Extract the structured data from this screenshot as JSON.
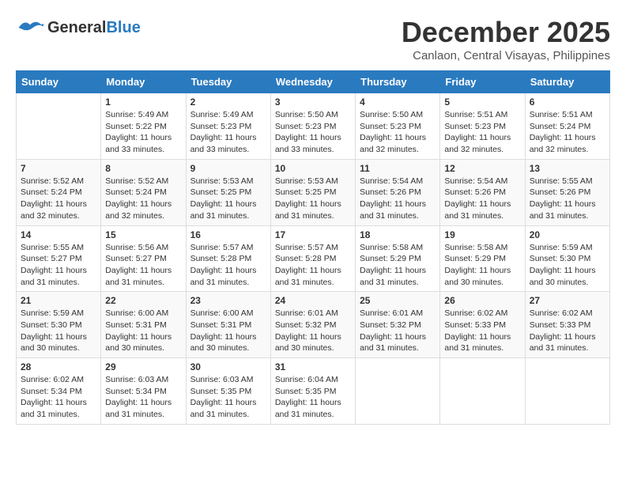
{
  "header": {
    "logo_general": "General",
    "logo_blue": "Blue",
    "month": "December 2025",
    "location": "Canlaon, Central Visayas, Philippines"
  },
  "weekdays": [
    "Sunday",
    "Monday",
    "Tuesday",
    "Wednesday",
    "Thursday",
    "Friday",
    "Saturday"
  ],
  "weeks": [
    [
      {
        "day": "",
        "info": ""
      },
      {
        "day": "1",
        "info": "Sunrise: 5:49 AM\nSunset: 5:22 PM\nDaylight: 11 hours\nand 33 minutes."
      },
      {
        "day": "2",
        "info": "Sunrise: 5:49 AM\nSunset: 5:23 PM\nDaylight: 11 hours\nand 33 minutes."
      },
      {
        "day": "3",
        "info": "Sunrise: 5:50 AM\nSunset: 5:23 PM\nDaylight: 11 hours\nand 33 minutes."
      },
      {
        "day": "4",
        "info": "Sunrise: 5:50 AM\nSunset: 5:23 PM\nDaylight: 11 hours\nand 32 minutes."
      },
      {
        "day": "5",
        "info": "Sunrise: 5:51 AM\nSunset: 5:23 PM\nDaylight: 11 hours\nand 32 minutes."
      },
      {
        "day": "6",
        "info": "Sunrise: 5:51 AM\nSunset: 5:24 PM\nDaylight: 11 hours\nand 32 minutes."
      }
    ],
    [
      {
        "day": "7",
        "info": "Sunrise: 5:52 AM\nSunset: 5:24 PM\nDaylight: 11 hours\nand 32 minutes."
      },
      {
        "day": "8",
        "info": "Sunrise: 5:52 AM\nSunset: 5:24 PM\nDaylight: 11 hours\nand 32 minutes."
      },
      {
        "day": "9",
        "info": "Sunrise: 5:53 AM\nSunset: 5:25 PM\nDaylight: 11 hours\nand 31 minutes."
      },
      {
        "day": "10",
        "info": "Sunrise: 5:53 AM\nSunset: 5:25 PM\nDaylight: 11 hours\nand 31 minutes."
      },
      {
        "day": "11",
        "info": "Sunrise: 5:54 AM\nSunset: 5:26 PM\nDaylight: 11 hours\nand 31 minutes."
      },
      {
        "day": "12",
        "info": "Sunrise: 5:54 AM\nSunset: 5:26 PM\nDaylight: 11 hours\nand 31 minutes."
      },
      {
        "day": "13",
        "info": "Sunrise: 5:55 AM\nSunset: 5:26 PM\nDaylight: 11 hours\nand 31 minutes."
      }
    ],
    [
      {
        "day": "14",
        "info": "Sunrise: 5:55 AM\nSunset: 5:27 PM\nDaylight: 11 hours\nand 31 minutes."
      },
      {
        "day": "15",
        "info": "Sunrise: 5:56 AM\nSunset: 5:27 PM\nDaylight: 11 hours\nand 31 minutes."
      },
      {
        "day": "16",
        "info": "Sunrise: 5:57 AM\nSunset: 5:28 PM\nDaylight: 11 hours\nand 31 minutes."
      },
      {
        "day": "17",
        "info": "Sunrise: 5:57 AM\nSunset: 5:28 PM\nDaylight: 11 hours\nand 31 minutes."
      },
      {
        "day": "18",
        "info": "Sunrise: 5:58 AM\nSunset: 5:29 PM\nDaylight: 11 hours\nand 31 minutes."
      },
      {
        "day": "19",
        "info": "Sunrise: 5:58 AM\nSunset: 5:29 PM\nDaylight: 11 hours\nand 30 minutes."
      },
      {
        "day": "20",
        "info": "Sunrise: 5:59 AM\nSunset: 5:30 PM\nDaylight: 11 hours\nand 30 minutes."
      }
    ],
    [
      {
        "day": "21",
        "info": "Sunrise: 5:59 AM\nSunset: 5:30 PM\nDaylight: 11 hours\nand 30 minutes."
      },
      {
        "day": "22",
        "info": "Sunrise: 6:00 AM\nSunset: 5:31 PM\nDaylight: 11 hours\nand 30 minutes."
      },
      {
        "day": "23",
        "info": "Sunrise: 6:00 AM\nSunset: 5:31 PM\nDaylight: 11 hours\nand 30 minutes."
      },
      {
        "day": "24",
        "info": "Sunrise: 6:01 AM\nSunset: 5:32 PM\nDaylight: 11 hours\nand 30 minutes."
      },
      {
        "day": "25",
        "info": "Sunrise: 6:01 AM\nSunset: 5:32 PM\nDaylight: 11 hours\nand 31 minutes."
      },
      {
        "day": "26",
        "info": "Sunrise: 6:02 AM\nSunset: 5:33 PM\nDaylight: 11 hours\nand 31 minutes."
      },
      {
        "day": "27",
        "info": "Sunrise: 6:02 AM\nSunset: 5:33 PM\nDaylight: 11 hours\nand 31 minutes."
      }
    ],
    [
      {
        "day": "28",
        "info": "Sunrise: 6:02 AM\nSunset: 5:34 PM\nDaylight: 11 hours\nand 31 minutes."
      },
      {
        "day": "29",
        "info": "Sunrise: 6:03 AM\nSunset: 5:34 PM\nDaylight: 11 hours\nand 31 minutes."
      },
      {
        "day": "30",
        "info": "Sunrise: 6:03 AM\nSunset: 5:35 PM\nDaylight: 11 hours\nand 31 minutes."
      },
      {
        "day": "31",
        "info": "Sunrise: 6:04 AM\nSunset: 5:35 PM\nDaylight: 11 hours\nand 31 minutes."
      },
      {
        "day": "",
        "info": ""
      },
      {
        "day": "",
        "info": ""
      },
      {
        "day": "",
        "info": ""
      }
    ]
  ]
}
